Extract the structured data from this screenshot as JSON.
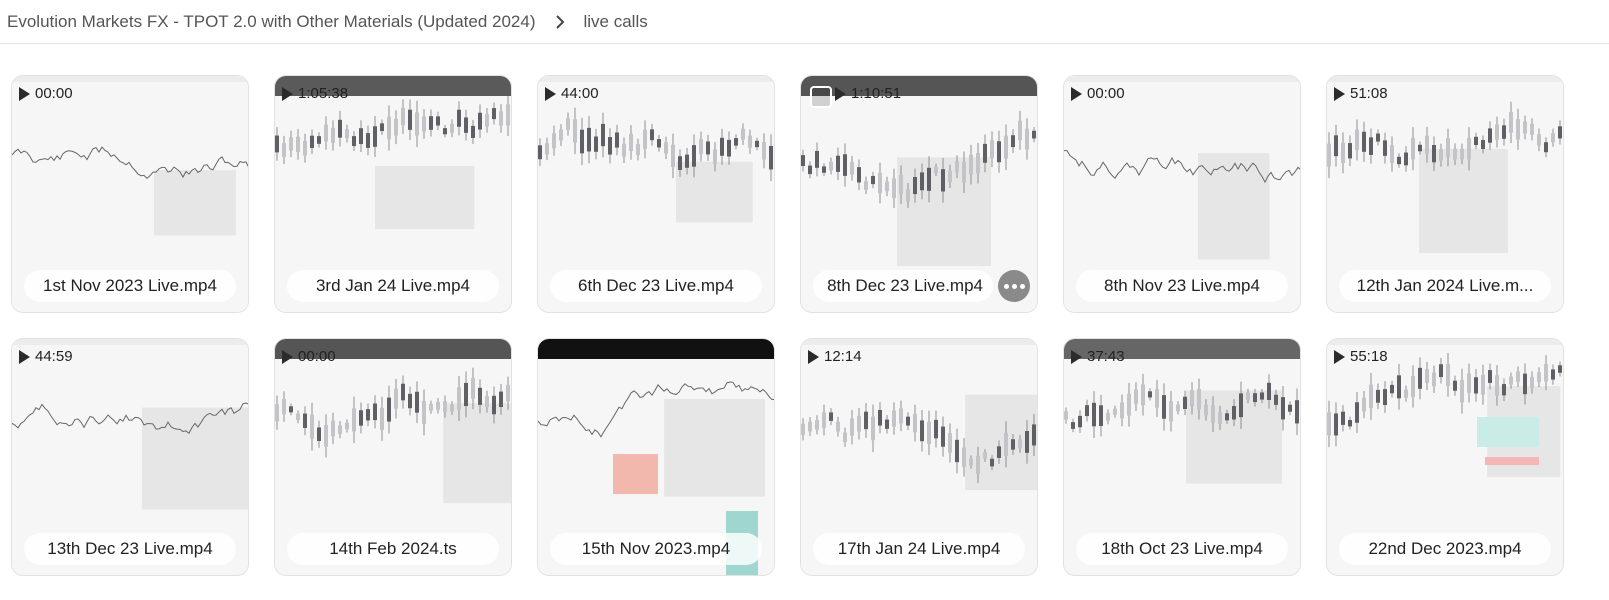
{
  "breadcrumb": {
    "parent": "Evolution Markets FX - TPOT 2.0 with Other Materials (Updated 2024)",
    "current": "live calls"
  },
  "videos": [
    {
      "title": "1st Nov 2023 Live.mp4",
      "duration": "00:00",
      "topbar": ""
    },
    {
      "title": "3rd Jan 24 Live.mp4",
      "duration": "1:05:38",
      "topbar": "#5a5a5a"
    },
    {
      "title": "6th Dec 23 Live.mp4",
      "duration": "44:00",
      "topbar": ""
    },
    {
      "title": "8th Dec 23 Live.mp4",
      "duration": "1:10:51",
      "topbar": "#555555",
      "hovered": true
    },
    {
      "title": "8th Nov 23 Live.mp4",
      "duration": "00:00",
      "topbar": ""
    },
    {
      "title": "12th Jan 2024 Live.m...",
      "duration": "51:08",
      "topbar": ""
    },
    {
      "title": "13th Dec 23 Live.mp4",
      "duration": "44:59",
      "topbar": ""
    },
    {
      "title": "14th Feb 2024.ts",
      "duration": "00:00",
      "topbar": "#555555"
    },
    {
      "title": "15th Nov 2023.mp4",
      "duration": "",
      "topbar": "#111111"
    },
    {
      "title": "17th Jan 24 Live.mp4",
      "duration": "12:14",
      "topbar": ""
    },
    {
      "title": "18th Oct 23 Live.mp4",
      "duration": "37:43",
      "topbar": "#666666"
    },
    {
      "title": "22nd Dec 2023.mp4",
      "duration": "55:18",
      "topbar": ""
    }
  ],
  "colors": {
    "text": "#333333",
    "border": "#e2e2e2",
    "candle": "#5f5f66",
    "zone": "#e6e6e6"
  }
}
